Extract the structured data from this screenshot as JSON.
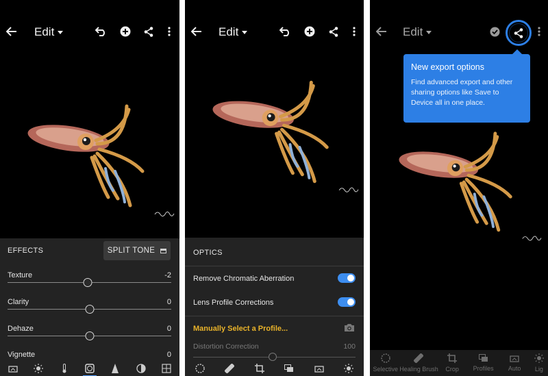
{
  "panels": [
    {
      "title": "Edit",
      "section_title": "EFFECTS",
      "split_tone_label": "SPLIT TONE",
      "sliders": [
        {
          "label": "Texture",
          "value": "-2",
          "level": 0.49
        },
        {
          "label": "Clarity",
          "value": "0",
          "level": 0.5
        },
        {
          "label": "Dehaze",
          "value": "0",
          "level": 0.5
        },
        {
          "label": "Vignette",
          "value": "0",
          "level": 0.5
        }
      ]
    },
    {
      "title": "Edit",
      "section_title": "OPTICS",
      "chromatic_label": "Remove Chromatic Aberration",
      "chromatic_on": true,
      "lens_label": "Lens Profile Corrections",
      "lens_on": true,
      "profile_link": "Manually Select a Profile...",
      "distortion_label": "Distortion Correction",
      "distortion_value": "100"
    },
    {
      "title": "Edit",
      "tooltip_title": "New export options",
      "tooltip_body": "Find advanced export and other sharing options like Save to Device all in one place.",
      "tools": [
        {
          "label": "Selective",
          "icon": "selective-icon"
        },
        {
          "label": "Healing Brush",
          "icon": "healing-brush-icon"
        },
        {
          "label": "Crop",
          "icon": "crop-icon"
        },
        {
          "label": "Profiles",
          "icon": "profiles-icon"
        },
        {
          "label": "Auto",
          "icon": "auto-icon"
        },
        {
          "label": "Lig",
          "icon": "light-icon"
        }
      ]
    }
  ],
  "colors": {
    "accent": "#2d7fe5",
    "panel_bg": "#232323",
    "link": "#e8b22a"
  }
}
